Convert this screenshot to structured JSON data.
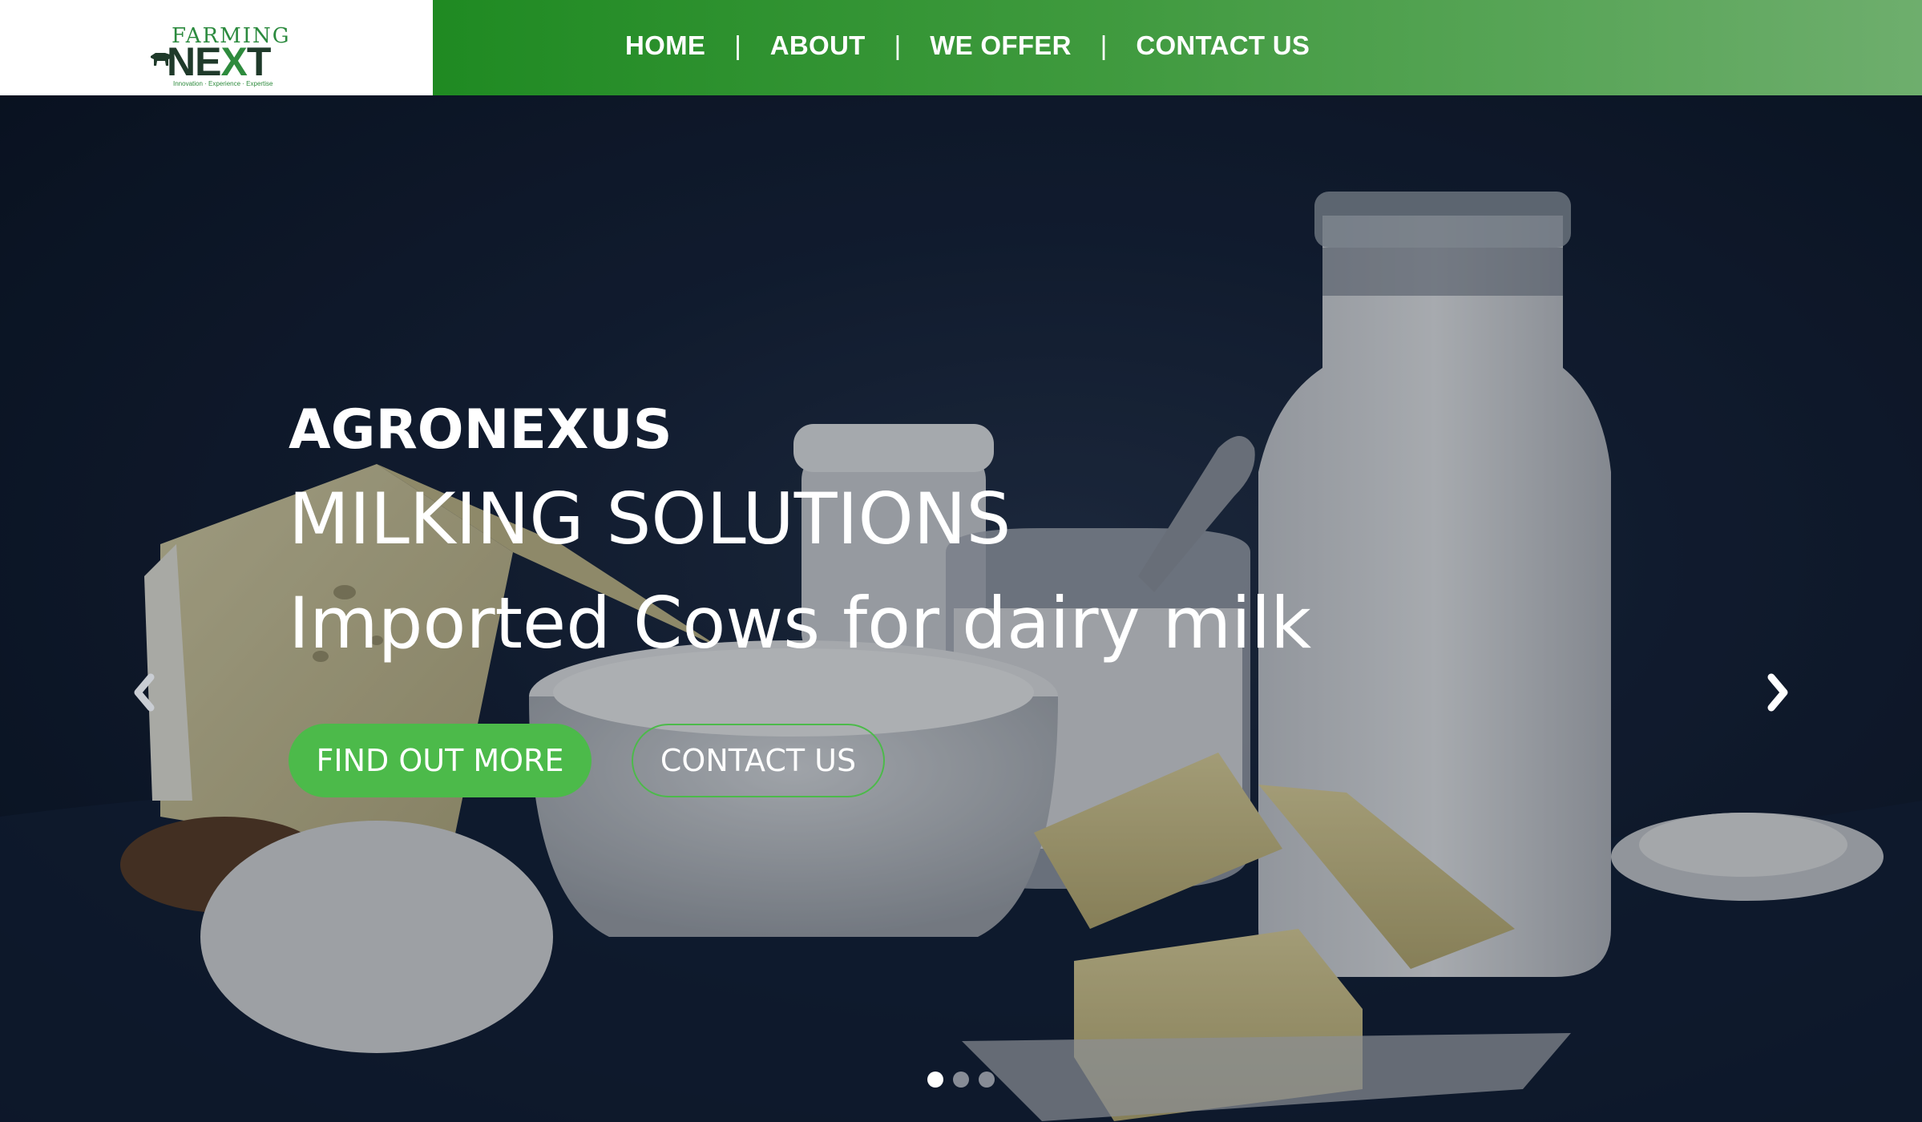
{
  "logo": {
    "top_text": "FARMING",
    "main_text_a": "NE",
    "main_text_x": "X",
    "main_text_b": "T",
    "tagline": "Innovation · Experience · Expertise"
  },
  "nav": {
    "items": [
      {
        "label": "HOME"
      },
      {
        "label": "ABOUT"
      },
      {
        "label": "WE OFFER"
      },
      {
        "label": "CONTACT US"
      }
    ],
    "separator": "|"
  },
  "hero": {
    "brand": "AGRONEXUS",
    "line2": "MILKING SOLUTIONS",
    "line3": "Imported Cows for dairy milk",
    "primary_button": "FIND OUT MORE",
    "secondary_button": "CONTACT US",
    "slides_total": 3,
    "active_slide": 1
  },
  "colors": {
    "nav_green": "#1f8a22",
    "button_green": "#4cba4a",
    "logo_green": "#2e8b3d"
  },
  "icons": {
    "prev": "chevron-left-icon",
    "next": "chevron-right-icon"
  }
}
